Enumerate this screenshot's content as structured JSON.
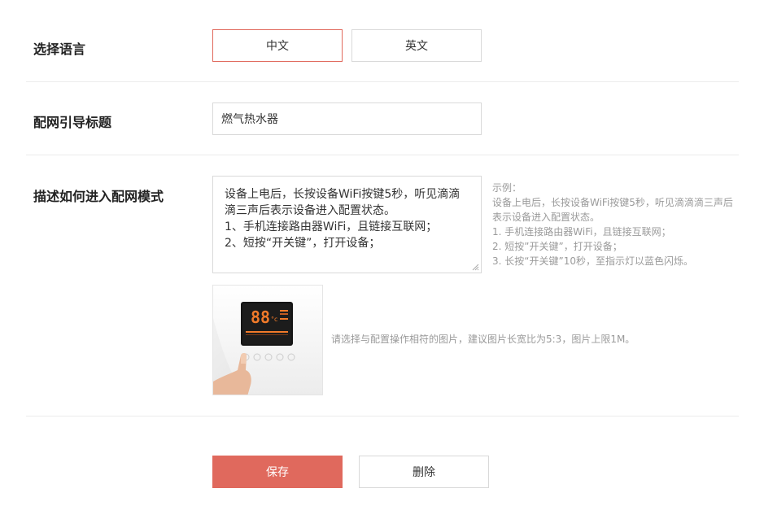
{
  "language": {
    "label": "选择语言",
    "options": [
      {
        "label": "中文",
        "selected": true
      },
      {
        "label": "英文",
        "selected": false
      }
    ]
  },
  "title_field": {
    "label": "配网引导标题",
    "value": "燃气热水器"
  },
  "description": {
    "label": "描述如何进入配网模式",
    "lines": [
      "设备上电后，长按设备WiFi按键5秒，听见滴滴滴三声后表示设备进入配置状态。",
      "1、手机连接路由器WiFi，且链接互联网；",
      "2、短按“开关键”，打开设备；"
    ],
    "example": [
      "示例：",
      "设备上电后，长按设备WiFi按键5秒，听见滴滴滴三声后表示设备进入配置状态。",
      "1. 手机连接路由器WiFi，且链接互联网；",
      "2. 短按”开关键”，打开设备；",
      "3. 长按“开关键”10秒，至指示灯以蓝色闪烁。"
    ],
    "image_hint": "请选择与配置操作相符的图片，建议图片长宽比为5:3，图片上限1M。",
    "image_display": "88"
  },
  "actions": {
    "save_label": "保存",
    "delete_label": "删除"
  },
  "colors": {
    "accent": "#e0695d",
    "border": "#d9d9d9",
    "muted_text": "#9a9a9a"
  }
}
